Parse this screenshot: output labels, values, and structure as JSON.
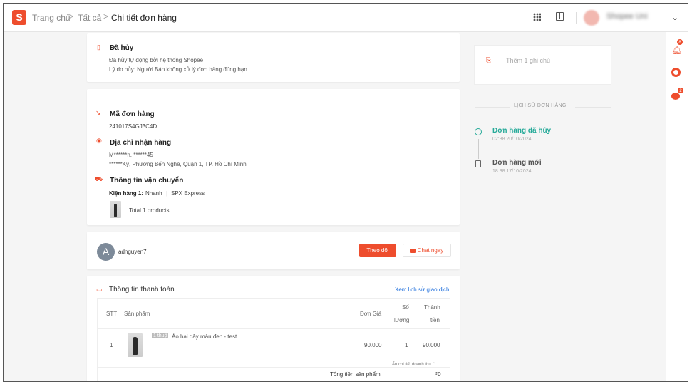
{
  "breadcrumb": {
    "logo": "S",
    "home": "Trang chủ",
    "all": "Tất cả",
    "current": "Chi tiết đơn hàng",
    "separator": ">"
  },
  "header": {
    "shop_name": "Shopee Uni"
  },
  "status_card": {
    "title": "Đã hủy",
    "line1": "Đã hủy tự động bởi hệ thống Shopee",
    "line2": "Lý do hủy: Người Bán không xử lý đơn hàng đúng hạn"
  },
  "order_card": {
    "order_id_title": "Mã đơn hàng",
    "order_id": "241017S4GJ3C4D",
    "address_title": "Địa chỉ nhận hàng",
    "address_name": "M******n, ******45",
    "address_line": "******Ký, Phường Bến Nghé, Quận 1, TP. Hồ Chí Minh",
    "shipping_title": "Thông tin vận chuyển",
    "package_label": "Kiện hàng 1:",
    "shipping_speed": "Nhanh",
    "carrier": "SPX Express",
    "total_products": "Total 1 products"
  },
  "buyer": {
    "avatar_letter": "A",
    "username": "adnguyen7",
    "follow_label": "Theo dõi",
    "chat_label": "Chat ngay"
  },
  "payment": {
    "title": "Thông tin thanh toán",
    "history_link": "Xem lịch sử giao dịch",
    "columns": {
      "stt": "STT",
      "product": "Sản phẩm",
      "unit_price": "Đơn Giá",
      "qty_1": "Số",
      "qty_2": "lượng",
      "total_1": "Thành",
      "total_2": "tiền"
    },
    "rows": [
      {
        "stt": "1",
        "tag": "1 thuộ",
        "name": "Áo hai dây màu đen - test",
        "unit_price": "90.000",
        "qty": "1",
        "total": "90.000"
      }
    ],
    "hide_details": "Ẩn chi tiết doanh thu",
    "subtotal_label": "Tổng tiền sản phẩm",
    "subtotal_value": "₫0"
  },
  "sidebar": {
    "note_placeholder": "Thêm 1 ghi chú",
    "history_title": "LỊCH SỬ ĐƠN HÀNG",
    "events": [
      {
        "title": "Đơn hàng đã hủy",
        "time": "02:38 20/10/2024"
      },
      {
        "title": "Đơn hàng mới",
        "time": "18:38 17/10/2024"
      }
    ]
  },
  "floating": {
    "notif_badge": "8",
    "chat_badge": "2"
  },
  "colors": {
    "accent": "#ee4d2d",
    "teal": "#26aa99",
    "link": "#2673dd"
  }
}
